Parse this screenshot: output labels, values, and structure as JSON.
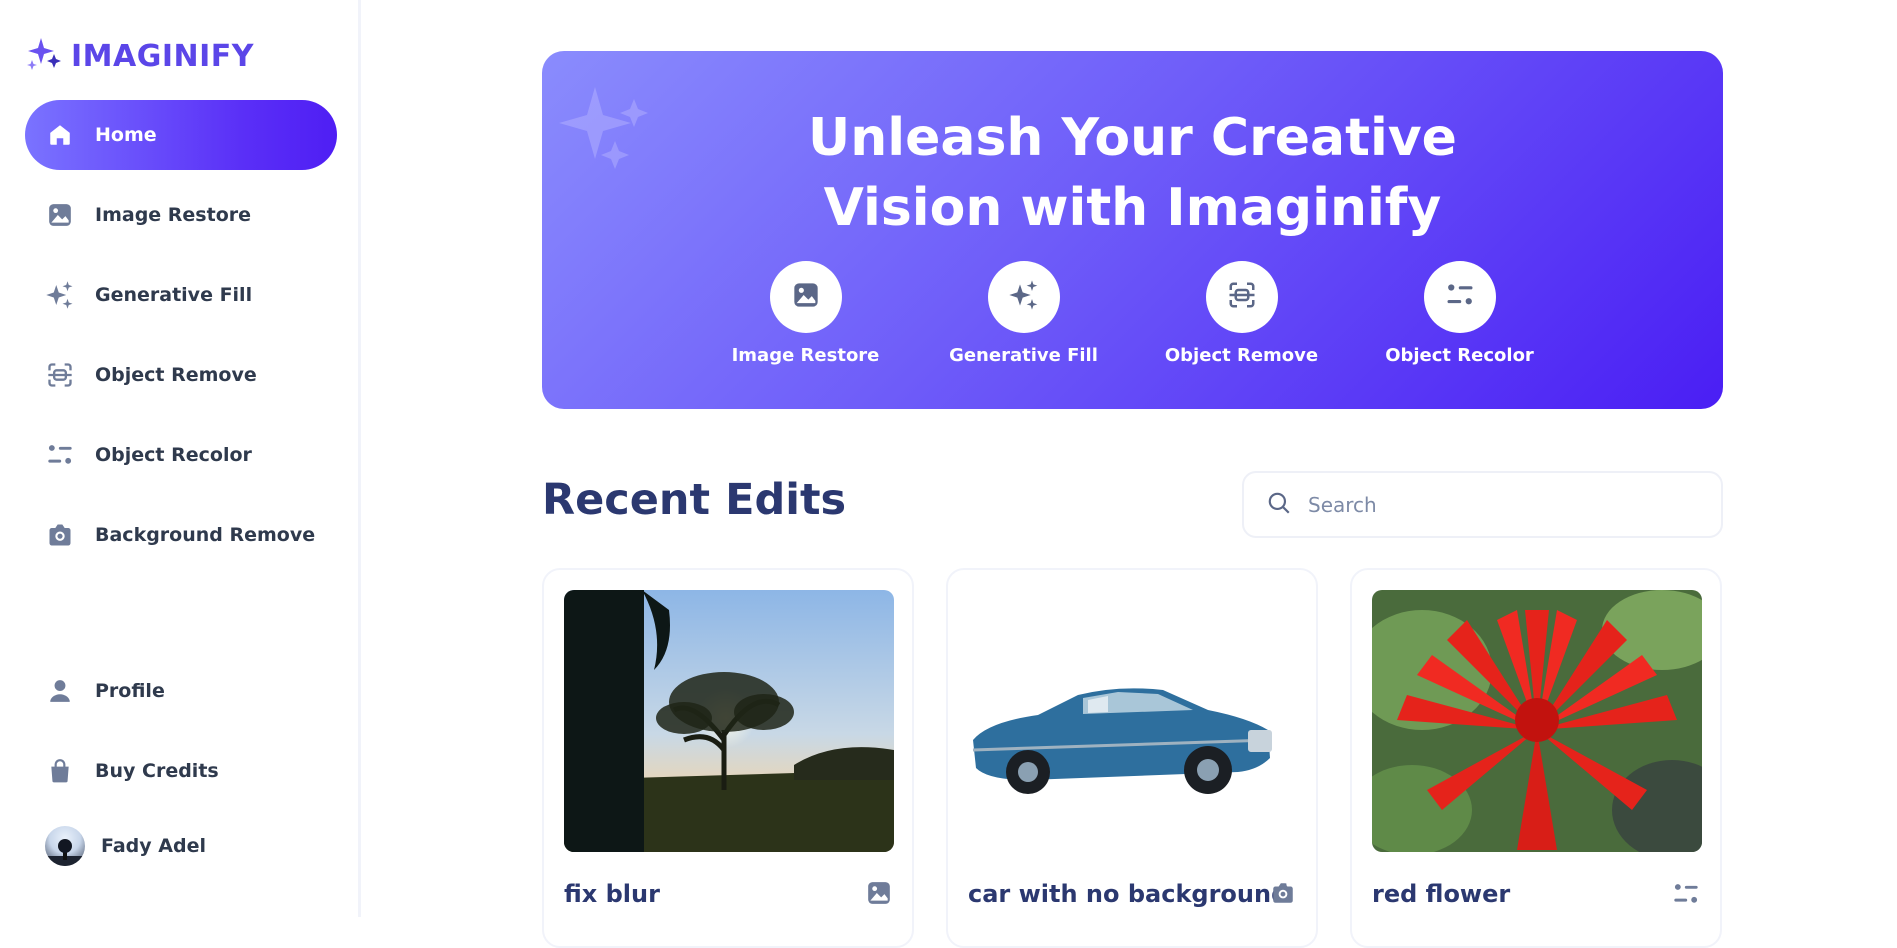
{
  "brand": {
    "name": "IMAGINIFY",
    "color": "#5b46e8"
  },
  "sidebar": {
    "items": [
      {
        "label": "Home",
        "icon": "home-icon",
        "active": true
      },
      {
        "label": "Image Restore",
        "icon": "image-icon"
      },
      {
        "label": "Generative Fill",
        "icon": "sparkles-icon"
      },
      {
        "label": "Object Remove",
        "icon": "scan-icon"
      },
      {
        "label": "Object Recolor",
        "icon": "filter-icon"
      },
      {
        "label": "Background Remove",
        "icon": "camera-icon"
      }
    ],
    "bottom": [
      {
        "label": "Profile",
        "icon": "user-icon"
      },
      {
        "label": "Buy Credits",
        "icon": "bag-icon"
      }
    ],
    "user": {
      "name": "Fady Adel"
    }
  },
  "banner": {
    "title_line1": "Unleash Your Creative",
    "title_line2": "Vision with Imaginify",
    "actions": [
      {
        "label": "Image Restore",
        "icon": "image-icon"
      },
      {
        "label": "Generative Fill",
        "icon": "sparkles-icon"
      },
      {
        "label": "Object Remove",
        "icon": "scan-icon"
      },
      {
        "label": "Object Recolor",
        "icon": "filter-icon"
      }
    ],
    "gradient_start": "#8a8cfd",
    "gradient_end": "#4a1ef4"
  },
  "recent": {
    "title": "Recent Edits",
    "search_placeholder": "Search",
    "cards": [
      {
        "title": "fix blur",
        "icon": "image-icon"
      },
      {
        "title": "car with no background",
        "icon": "camera-icon"
      },
      {
        "title": "red flower",
        "icon": "filter-icon"
      }
    ]
  }
}
